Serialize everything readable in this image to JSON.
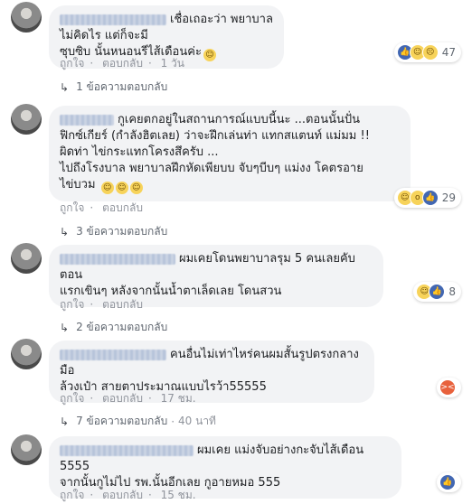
{
  "comments": [
    {
      "text": "เชื่อเถอะว่า พยาบาลไม่คิดไร แต่ก็จะมี\nซุบซิบ นั้นหนอนรีไส้เดือนค่ะ",
      "emoji_after": [
        "haha"
      ],
      "reactions": [
        "like",
        "haha",
        "sad"
      ],
      "count": "47",
      "like_label": "ถูกใจ",
      "reply_label": "ตอบกลับ",
      "time": "1 วัน",
      "replies_label": "1 ข้อความตอบกลับ",
      "replies_ago": ""
    },
    {
      "text": "กูเคยตกอยู่ในสถานการณ์แบบนี้นะ ...ตอนนั้นปั่น\nฟิกซ์เกียร์ (กำลังฮิตเลย) ว่าจะฝึกเล่นท่า แทกสแตนท์ แม่มม !!\nผิดท่า ไข่กระแทกโครงสึครับ ...\nไปถึงโรงบาล พยาบาลฝึกหัดเพียบบ จับๆบีบๆ แม่งง โคตรอาย\nไข่บวม",
      "emoji_after": [
        "haha",
        "haha",
        "haha"
      ],
      "reactions": [
        "haha",
        "wow",
        "like"
      ],
      "count": "29",
      "like_label": "ถูกใจ",
      "reply_label": "ตอบกลับ",
      "time": "",
      "replies_label": "3 ข้อความตอบกลับ",
      "replies_ago": ""
    },
    {
      "text": "ผมเคยโดนพยาบาลรุม 5 คนเลยคับ ตอน\nแรกเขินๆ หลังจากนั้นน้ำตาเล็ดเลย โดนสวน",
      "emoji_after": [],
      "reactions": [
        "haha",
        "like"
      ],
      "count": "8",
      "like_label": "ถูกใจ",
      "reply_label": "ตอบกลับ",
      "time": "",
      "replies_label": "2 ข้อความตอบกลับ",
      "replies_ago": ""
    },
    {
      "text": "คนอื่นไม่เท่าไหร่คนผมสั้นรูปตรงกลาง มือ\nล้วงเป๋า สายตาประมาณแบบไรว้า55555",
      "emoji_after": [],
      "reactions": [
        "angry"
      ],
      "count": "",
      "like_label": "ถูกใจ",
      "reply_label": "ตอบกลับ",
      "time": "17 ชม.",
      "replies_label": "7 ข้อความตอบกลับ",
      "replies_ago": "40 นาที"
    },
    {
      "text": "ผมเคย แม่งจับอย่างกะจับไส้เดือน 5555\nจากนั้นกูไม่ไป รพ.นั้นอีกเลย กูอายหมอ 555",
      "emoji_after": [],
      "reactions": [
        "like"
      ],
      "count": "",
      "like_label": "ถูกใจ",
      "reply_label": "ตอบกลับ",
      "time": "15 ชม.",
      "replies_label": "",
      "replies_ago": ""
    }
  ]
}
